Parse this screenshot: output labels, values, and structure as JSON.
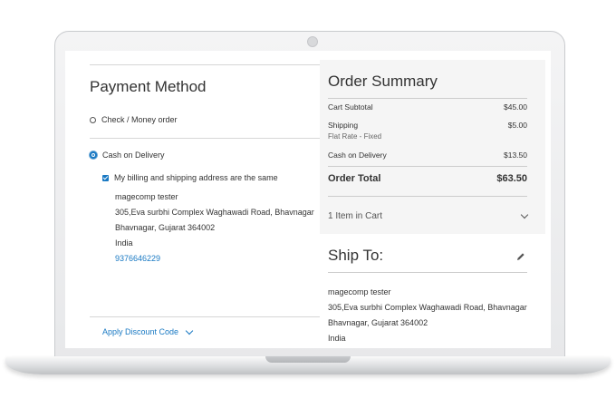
{
  "payment": {
    "title": "Payment Method",
    "options": [
      {
        "label": "Check / Money order",
        "selected": false
      },
      {
        "label": "Cash on Delivery",
        "selected": true
      }
    ],
    "same_address_label": "My billing and shipping address are the same",
    "address": {
      "name": "magecomp tester",
      "street": "305,Eva surbhi Complex Waghawadi Road, Bhavnagar",
      "city": "Bhavnagar, Gujarat 364002",
      "country": "India",
      "phone": "9376646229"
    },
    "discount_label": "Apply Discount Code"
  },
  "summary": {
    "title": "Order Summary",
    "cart_subtotal_label": "Cart Subtotal",
    "cart_subtotal": "$45.00",
    "shipping_label": "Shipping",
    "shipping_value": "$5.00",
    "shipping_method": "Flat Rate - Fixed",
    "cod_label": "Cash on Delivery",
    "cod_value": "$13.50",
    "total_label": "Order Total",
    "total_value": "$63.50",
    "items_in_cart": "1 Item in Cart"
  },
  "ship_to": {
    "title": "Ship To:",
    "name": "magecomp tester",
    "street": "305,Eva surbhi Complex Waghawadi Road, Bhavnagar",
    "city": "Bhavnagar, Gujarat 364002",
    "country": "India"
  },
  "colors": {
    "accent": "#1979c3",
    "summary_bg": "#f5f5f5"
  }
}
